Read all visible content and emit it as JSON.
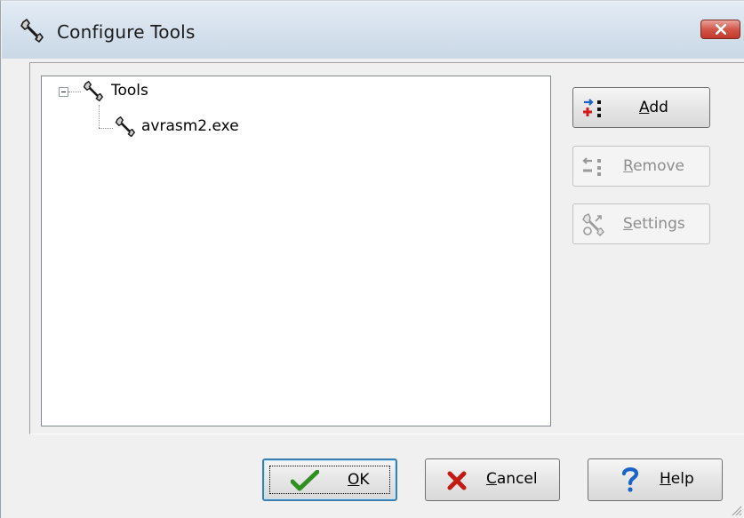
{
  "window": {
    "title": "Configure Tools",
    "icon": "wrench-icon",
    "close_icon": "close-icon"
  },
  "tree": {
    "root": {
      "label": "Tools",
      "icon": "wrench-icon",
      "expanded": true
    },
    "children": [
      {
        "label": "avrasm2.exe",
        "icon": "wrench-icon"
      }
    ]
  },
  "side_buttons": {
    "add": {
      "mnemonic": "A",
      "rest": "dd",
      "icon": "add-tool-icon",
      "enabled": true
    },
    "remove": {
      "mnemonic": "R",
      "rest": "emove",
      "icon": "remove-tool-icon",
      "enabled": false
    },
    "settings": {
      "mnemonic": "S",
      "rest": "ettings",
      "icon": "settings-icon",
      "enabled": false
    }
  },
  "footer_buttons": {
    "ok": {
      "mnemonic": "O",
      "rest": "K",
      "icon": "checkmark-icon",
      "default": true
    },
    "cancel": {
      "mnemonic": "C",
      "rest": "ancel",
      "icon": "x-icon"
    },
    "help": {
      "mnemonic": "H",
      "rest": "elp",
      "icon": "question-icon"
    }
  },
  "colors": {
    "accent_blue": "#1c63c8",
    "check_green": "#2f8f20",
    "cancel_red": "#c31a12",
    "close_red": "#c2382b"
  }
}
